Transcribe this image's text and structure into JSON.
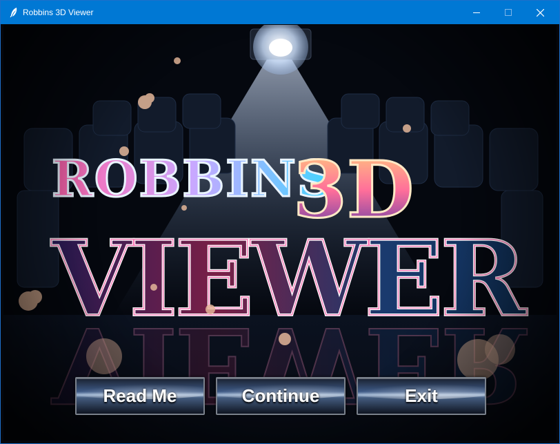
{
  "window": {
    "title": "Robbins 3D Viewer",
    "controls": {
      "minimize": "minimize",
      "maximize": "maximize",
      "close": "close"
    }
  },
  "splash": {
    "logo_line1": "Robbins",
    "logo_line2": "3D",
    "logo_line3": "VIEWER"
  },
  "menu": {
    "read_me": "Read Me",
    "continue": "Continue",
    "exit": "Exit"
  },
  "colors": {
    "titlebar": "#0078d4",
    "logo_pink": "#ff5fa8",
    "logo_cyan": "#3fd6ff",
    "logo_orange": "#ff9a3c"
  }
}
